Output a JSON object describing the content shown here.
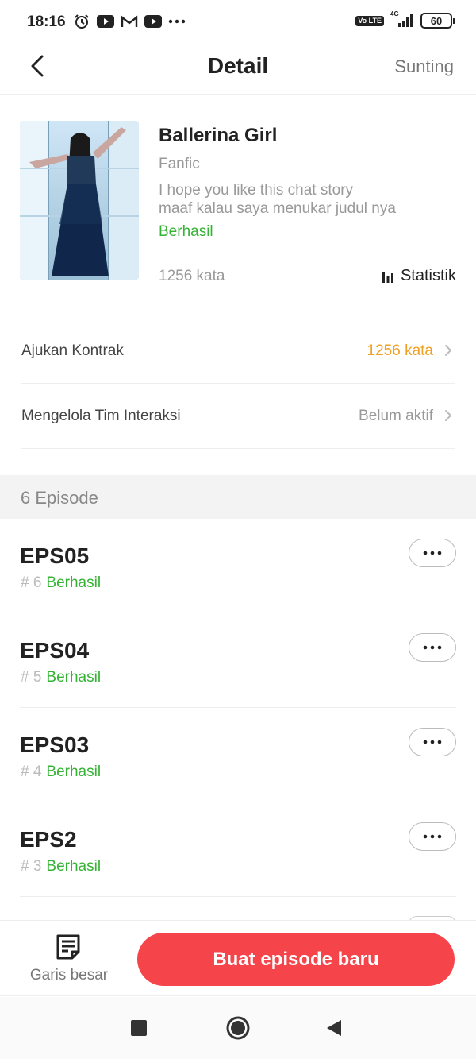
{
  "status_bar": {
    "time": "18:16",
    "network": "4G",
    "volte": "Vo LTE",
    "battery": "60",
    "icons": [
      "alarm-icon",
      "youtube-icon",
      "gmail-icon",
      "youtube-icon",
      "more-dots-icon",
      "volte-icon",
      "signal-icon",
      "battery-icon"
    ]
  },
  "header": {
    "title": "Detail",
    "edit_label": "Sunting"
  },
  "book": {
    "title": "Ballerina Girl",
    "genre": "Fanfic",
    "description_line1": "I hope you like this chat story",
    "description_line2": "maaf kalau saya menukar judul nya",
    "status": "Berhasil",
    "word_count": "1256 kata",
    "stats_label": "Statistik"
  },
  "rows": [
    {
      "label": "Ajukan Kontrak",
      "value": "1256 kata",
      "value_color": "#f0a020"
    },
    {
      "label": "Mengelola Tim Interaksi",
      "value": "Belum aktif",
      "value_color": "#999999"
    }
  ],
  "episodes": {
    "header": "6 Episode",
    "items": [
      {
        "title": "EPS05",
        "number": "# 6",
        "status": "Berhasil"
      },
      {
        "title": "EPS04",
        "number": "# 5",
        "status": "Berhasil"
      },
      {
        "title": "EPS03",
        "number": "# 4",
        "status": "Berhasil"
      },
      {
        "title": "EPS2",
        "number": "# 3",
        "status": "Berhasil"
      }
    ]
  },
  "bottom_bar": {
    "outline_label": "Garis besar",
    "create_label": "Buat episode baru"
  },
  "colors": {
    "accent_red": "#f5454b",
    "success_green": "#34b334",
    "orange": "#f0a020"
  }
}
